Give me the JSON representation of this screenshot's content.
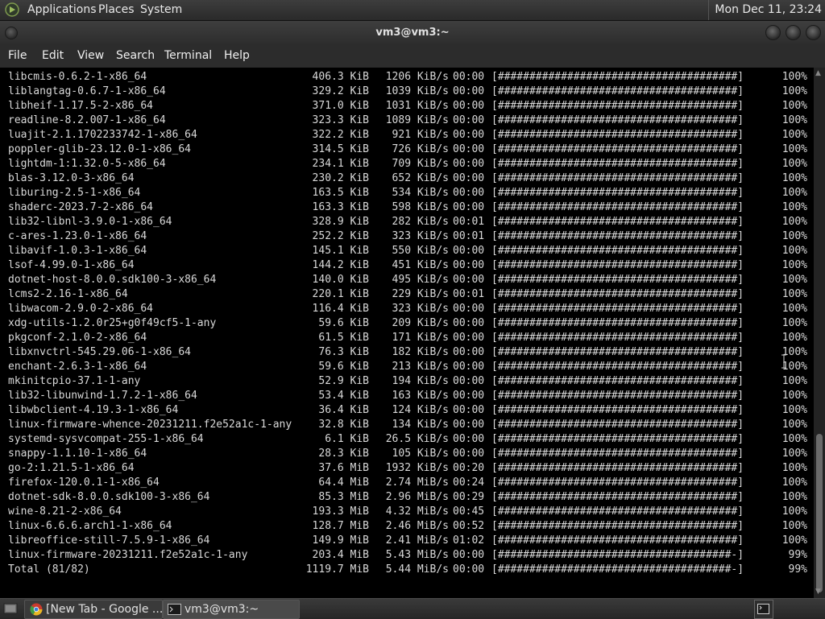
{
  "top_panel": {
    "menus": [
      "Applications",
      "Places",
      "System"
    ],
    "clock": "Mon Dec 11, 23:24"
  },
  "window": {
    "title": "vm3@vm3:~"
  },
  "menubar": [
    "File",
    "Edit",
    "View",
    "Search",
    "Terminal",
    "Help"
  ],
  "terminal": {
    "rows": [
      {
        "name": "libcmis-0.6.2-1-x86_64",
        "size": "406.3 KiB",
        "rate": "1206 KiB/s",
        "time": "00:00",
        "bar": "[######################################]",
        "pct": "100%"
      },
      {
        "name": "liblangtag-0.6.7-1-x86_64",
        "size": "329.2 KiB",
        "rate": "1039 KiB/s",
        "time": "00:00",
        "bar": "[######################################]",
        "pct": "100%"
      },
      {
        "name": "libheif-1.17.5-2-x86_64",
        "size": "371.0 KiB",
        "rate": "1031 KiB/s",
        "time": "00:00",
        "bar": "[######################################]",
        "pct": "100%"
      },
      {
        "name": "readline-8.2.007-1-x86_64",
        "size": "323.3 KiB",
        "rate": "1089 KiB/s",
        "time": "00:00",
        "bar": "[######################################]",
        "pct": "100%"
      },
      {
        "name": "luajit-2.1.1702233742-1-x86_64",
        "size": "322.2 KiB",
        "rate": "921 KiB/s",
        "time": "00:00",
        "bar": "[######################################]",
        "pct": "100%"
      },
      {
        "name": "poppler-glib-23.12.0-1-x86_64",
        "size": "314.5 KiB",
        "rate": "726 KiB/s",
        "time": "00:00",
        "bar": "[######################################]",
        "pct": "100%"
      },
      {
        "name": "lightdm-1:1.32.0-5-x86_64",
        "size": "234.1 KiB",
        "rate": "709 KiB/s",
        "time": "00:00",
        "bar": "[######################################]",
        "pct": "100%"
      },
      {
        "name": "blas-3.12.0-3-x86_64",
        "size": "230.2 KiB",
        "rate": "652 KiB/s",
        "time": "00:00",
        "bar": "[######################################]",
        "pct": "100%"
      },
      {
        "name": "liburing-2.5-1-x86_64",
        "size": "163.5 KiB",
        "rate": "534 KiB/s",
        "time": "00:00",
        "bar": "[######################################]",
        "pct": "100%"
      },
      {
        "name": "shaderc-2023.7-2-x86_64",
        "size": "163.3 KiB",
        "rate": "598 KiB/s",
        "time": "00:00",
        "bar": "[######################################]",
        "pct": "100%"
      },
      {
        "name": "lib32-libnl-3.9.0-1-x86_64",
        "size": "328.9 KiB",
        "rate": "282 KiB/s",
        "time": "00:01",
        "bar": "[######################################]",
        "pct": "100%"
      },
      {
        "name": "c-ares-1.23.0-1-x86_64",
        "size": "252.2 KiB",
        "rate": "323 KiB/s",
        "time": "00:01",
        "bar": "[######################################]",
        "pct": "100%"
      },
      {
        "name": "libavif-1.0.3-1-x86_64",
        "size": "145.1 KiB",
        "rate": "550 KiB/s",
        "time": "00:00",
        "bar": "[######################################]",
        "pct": "100%"
      },
      {
        "name": "lsof-4.99.0-1-x86_64",
        "size": "144.2 KiB",
        "rate": "451 KiB/s",
        "time": "00:00",
        "bar": "[######################################]",
        "pct": "100%"
      },
      {
        "name": "dotnet-host-8.0.0.sdk100-3-x86_64",
        "size": "140.0 KiB",
        "rate": "495 KiB/s",
        "time": "00:00",
        "bar": "[######################################]",
        "pct": "100%"
      },
      {
        "name": "lcms2-2.16-1-x86_64",
        "size": "220.1 KiB",
        "rate": "229 KiB/s",
        "time": "00:01",
        "bar": "[######################################]",
        "pct": "100%"
      },
      {
        "name": "libwacom-2.9.0-2-x86_64",
        "size": "116.4 KiB",
        "rate": "323 KiB/s",
        "time": "00:00",
        "bar": "[######################################]",
        "pct": "100%"
      },
      {
        "name": "xdg-utils-1.2.0r25+g0f49cf5-1-any",
        "size": "59.6 KiB",
        "rate": "209 KiB/s",
        "time": "00:00",
        "bar": "[######################################]",
        "pct": "100%"
      },
      {
        "name": "pkgconf-2.1.0-2-x86_64",
        "size": "61.5 KiB",
        "rate": "171 KiB/s",
        "time": "00:00",
        "bar": "[######################################]",
        "pct": "100%"
      },
      {
        "name": "libxnvctrl-545.29.06-1-x86_64",
        "size": "76.3 KiB",
        "rate": "182 KiB/s",
        "time": "00:00",
        "bar": "[######################################]",
        "pct": "100%"
      },
      {
        "name": "enchant-2.6.3-1-x86_64",
        "size": "59.6 KiB",
        "rate": "213 KiB/s",
        "time": "00:00",
        "bar": "[######################################]",
        "pct": "100%"
      },
      {
        "name": "mkinitcpio-37.1-1-any",
        "size": "52.9 KiB",
        "rate": "194 KiB/s",
        "time": "00:00",
        "bar": "[######################################]",
        "pct": "100%"
      },
      {
        "name": "lib32-libunwind-1.7.2-1-x86_64",
        "size": "53.4 KiB",
        "rate": "163 KiB/s",
        "time": "00:00",
        "bar": "[######################################]",
        "pct": "100%"
      },
      {
        "name": "libwbclient-4.19.3-1-x86_64",
        "size": "36.4 KiB",
        "rate": "124 KiB/s",
        "time": "00:00",
        "bar": "[######################################]",
        "pct": "100%"
      },
      {
        "name": "linux-firmware-whence-20231211.f2e52a1c-1-any",
        "size": "32.8 KiB",
        "rate": "134 KiB/s",
        "time": "00:00",
        "bar": "[######################################]",
        "pct": "100%"
      },
      {
        "name": "systemd-sysvcompat-255-1-x86_64",
        "size": "6.1 KiB",
        "rate": "26.5 KiB/s",
        "time": "00:00",
        "bar": "[######################################]",
        "pct": "100%"
      },
      {
        "name": "snappy-1.1.10-1-x86_64",
        "size": "28.3 KiB",
        "rate": "105 KiB/s",
        "time": "00:00",
        "bar": "[######################################]",
        "pct": "100%"
      },
      {
        "name": "go-2:1.21.5-1-x86_64",
        "size": "37.6 MiB",
        "rate": "1932 KiB/s",
        "time": "00:20",
        "bar": "[######################################]",
        "pct": "100%"
      },
      {
        "name": "firefox-120.0.1-1-x86_64",
        "size": "64.4 MiB",
        "rate": "2.74 MiB/s",
        "time": "00:24",
        "bar": "[######################################]",
        "pct": "100%"
      },
      {
        "name": "dotnet-sdk-8.0.0.sdk100-3-x86_64",
        "size": "85.3 MiB",
        "rate": "2.96 MiB/s",
        "time": "00:29",
        "bar": "[######################################]",
        "pct": "100%"
      },
      {
        "name": "wine-8.21-2-x86_64",
        "size": "193.3 MiB",
        "rate": "4.32 MiB/s",
        "time": "00:45",
        "bar": "[######################################]",
        "pct": "100%"
      },
      {
        "name": "linux-6.6.6.arch1-1-x86_64",
        "size": "128.7 MiB",
        "rate": "2.46 MiB/s",
        "time": "00:52",
        "bar": "[######################################]",
        "pct": "100%"
      },
      {
        "name": "libreoffice-still-7.5.9-1-x86_64",
        "size": "149.9 MiB",
        "rate": "2.41 MiB/s",
        "time": "01:02",
        "bar": "[######################################]",
        "pct": "100%"
      },
      {
        "name": "linux-firmware-20231211.f2e52a1c-1-any",
        "size": "203.4 MiB",
        "rate": "5.43 MiB/s",
        "time": "00:00",
        "bar": "[#####################################-]",
        "pct": "99%"
      },
      {
        "name": "Total (81/82)",
        "size": "1119.7 MiB",
        "rate": "5.44 MiB/s",
        "time": "00:00",
        "bar": "[#####################################-]",
        "pct": "99%"
      }
    ]
  },
  "taskbar": {
    "tasks": [
      {
        "label": "[New Tab - Google ...",
        "icon": "chrome-icon"
      },
      {
        "label": "vm3@vm3:~",
        "icon": "terminal-icon"
      }
    ]
  }
}
